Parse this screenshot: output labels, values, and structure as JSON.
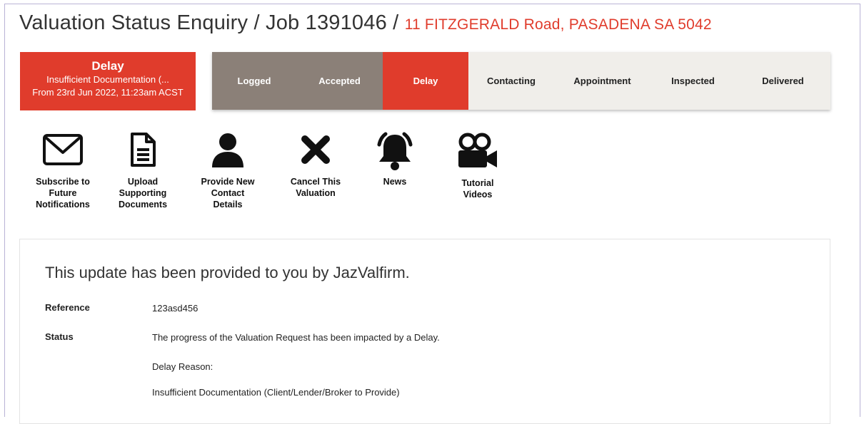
{
  "header": {
    "title": "Valuation Status Enquiry / Job 1391046 / ",
    "address": "11 FITZGERALD Road, PASADENA SA 5042"
  },
  "status": {
    "title": "Delay",
    "reason": "Insufficient Documentation (...",
    "since": "From 23rd Jun 2022, 11:23am ACST"
  },
  "steps": [
    {
      "label": "Logged",
      "state": "done"
    },
    {
      "label": "Accepted",
      "state": "done"
    },
    {
      "label": "Delay",
      "state": "current"
    },
    {
      "label": "Contacting",
      "state": "pending"
    },
    {
      "label": "Appointment",
      "state": "pending"
    },
    {
      "label": "Inspected",
      "state": "pending"
    },
    {
      "label": "Delivered",
      "state": "pending"
    }
  ],
  "actions": [
    {
      "icon": "envelope-icon",
      "label": "Subscribe to\nFuture\nNotifications"
    },
    {
      "icon": "document-icon",
      "label": "Upload\nSupporting\nDocuments"
    },
    {
      "icon": "user-icon",
      "label": "Provide New\nContact\nDetails"
    },
    {
      "icon": "close-icon",
      "label": "Cancel This\nValuation"
    },
    {
      "icon": "bell-icon",
      "label": "News"
    },
    {
      "icon": "video-camera-icon",
      "label": "Tutorial\nVideos"
    }
  ],
  "update": {
    "heading": "This update has been provided to you by JazValfirm.",
    "reference_label": "Reference",
    "reference_value": "123asd456",
    "status_label": "Status",
    "status_line1": "The progress of the Valuation Request has been impacted by a Delay.",
    "status_line2": "Delay Reason:",
    "status_line3": "Insufficient Documentation (Client/Lender/Broker to Provide)"
  },
  "colors": {
    "accent": "#e03c2c",
    "done": "#8b8078",
    "pending": "#f0eeea"
  }
}
